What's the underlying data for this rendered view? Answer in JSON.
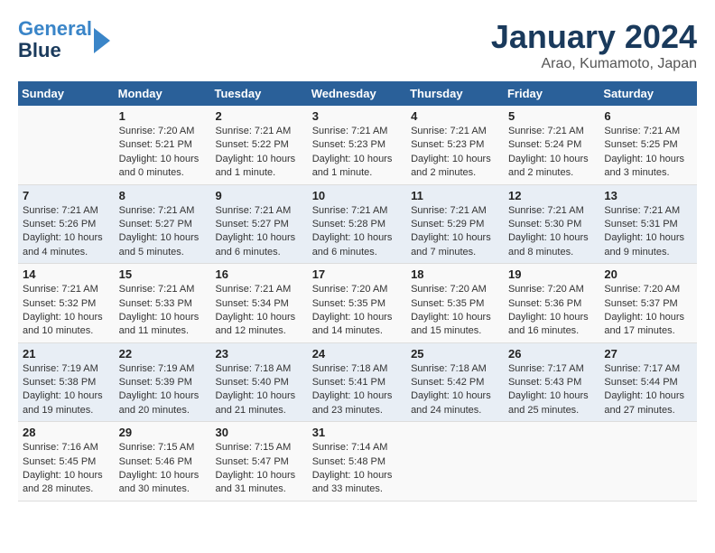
{
  "header": {
    "logo_line1": "General",
    "logo_line2": "Blue",
    "month_title": "January 2024",
    "location": "Arao, Kumamoto, Japan"
  },
  "days_of_week": [
    "Sunday",
    "Monday",
    "Tuesday",
    "Wednesday",
    "Thursday",
    "Friday",
    "Saturday"
  ],
  "weeks": [
    [
      {
        "day": "",
        "info": ""
      },
      {
        "day": "1",
        "info": "Sunrise: 7:20 AM\nSunset: 5:21 PM\nDaylight: 10 hours\nand 0 minutes."
      },
      {
        "day": "2",
        "info": "Sunrise: 7:21 AM\nSunset: 5:22 PM\nDaylight: 10 hours\nand 1 minute."
      },
      {
        "day": "3",
        "info": "Sunrise: 7:21 AM\nSunset: 5:23 PM\nDaylight: 10 hours\nand 1 minute."
      },
      {
        "day": "4",
        "info": "Sunrise: 7:21 AM\nSunset: 5:23 PM\nDaylight: 10 hours\nand 2 minutes."
      },
      {
        "day": "5",
        "info": "Sunrise: 7:21 AM\nSunset: 5:24 PM\nDaylight: 10 hours\nand 2 minutes."
      },
      {
        "day": "6",
        "info": "Sunrise: 7:21 AM\nSunset: 5:25 PM\nDaylight: 10 hours\nand 3 minutes."
      }
    ],
    [
      {
        "day": "7",
        "info": "Sunrise: 7:21 AM\nSunset: 5:26 PM\nDaylight: 10 hours\nand 4 minutes."
      },
      {
        "day": "8",
        "info": "Sunrise: 7:21 AM\nSunset: 5:27 PM\nDaylight: 10 hours\nand 5 minutes."
      },
      {
        "day": "9",
        "info": "Sunrise: 7:21 AM\nSunset: 5:27 PM\nDaylight: 10 hours\nand 6 minutes."
      },
      {
        "day": "10",
        "info": "Sunrise: 7:21 AM\nSunset: 5:28 PM\nDaylight: 10 hours\nand 6 minutes."
      },
      {
        "day": "11",
        "info": "Sunrise: 7:21 AM\nSunset: 5:29 PM\nDaylight: 10 hours\nand 7 minutes."
      },
      {
        "day": "12",
        "info": "Sunrise: 7:21 AM\nSunset: 5:30 PM\nDaylight: 10 hours\nand 8 minutes."
      },
      {
        "day": "13",
        "info": "Sunrise: 7:21 AM\nSunset: 5:31 PM\nDaylight: 10 hours\nand 9 minutes."
      }
    ],
    [
      {
        "day": "14",
        "info": "Sunrise: 7:21 AM\nSunset: 5:32 PM\nDaylight: 10 hours\nand 10 minutes."
      },
      {
        "day": "15",
        "info": "Sunrise: 7:21 AM\nSunset: 5:33 PM\nDaylight: 10 hours\nand 11 minutes."
      },
      {
        "day": "16",
        "info": "Sunrise: 7:21 AM\nSunset: 5:34 PM\nDaylight: 10 hours\nand 12 minutes."
      },
      {
        "day": "17",
        "info": "Sunrise: 7:20 AM\nSunset: 5:35 PM\nDaylight: 10 hours\nand 14 minutes."
      },
      {
        "day": "18",
        "info": "Sunrise: 7:20 AM\nSunset: 5:35 PM\nDaylight: 10 hours\nand 15 minutes."
      },
      {
        "day": "19",
        "info": "Sunrise: 7:20 AM\nSunset: 5:36 PM\nDaylight: 10 hours\nand 16 minutes."
      },
      {
        "day": "20",
        "info": "Sunrise: 7:20 AM\nSunset: 5:37 PM\nDaylight: 10 hours\nand 17 minutes."
      }
    ],
    [
      {
        "day": "21",
        "info": "Sunrise: 7:19 AM\nSunset: 5:38 PM\nDaylight: 10 hours\nand 19 minutes."
      },
      {
        "day": "22",
        "info": "Sunrise: 7:19 AM\nSunset: 5:39 PM\nDaylight: 10 hours\nand 20 minutes."
      },
      {
        "day": "23",
        "info": "Sunrise: 7:18 AM\nSunset: 5:40 PM\nDaylight: 10 hours\nand 21 minutes."
      },
      {
        "day": "24",
        "info": "Sunrise: 7:18 AM\nSunset: 5:41 PM\nDaylight: 10 hours\nand 23 minutes."
      },
      {
        "day": "25",
        "info": "Sunrise: 7:18 AM\nSunset: 5:42 PM\nDaylight: 10 hours\nand 24 minutes."
      },
      {
        "day": "26",
        "info": "Sunrise: 7:17 AM\nSunset: 5:43 PM\nDaylight: 10 hours\nand 25 minutes."
      },
      {
        "day": "27",
        "info": "Sunrise: 7:17 AM\nSunset: 5:44 PM\nDaylight: 10 hours\nand 27 minutes."
      }
    ],
    [
      {
        "day": "28",
        "info": "Sunrise: 7:16 AM\nSunset: 5:45 PM\nDaylight: 10 hours\nand 28 minutes."
      },
      {
        "day": "29",
        "info": "Sunrise: 7:15 AM\nSunset: 5:46 PM\nDaylight: 10 hours\nand 30 minutes."
      },
      {
        "day": "30",
        "info": "Sunrise: 7:15 AM\nSunset: 5:47 PM\nDaylight: 10 hours\nand 31 minutes."
      },
      {
        "day": "31",
        "info": "Sunrise: 7:14 AM\nSunset: 5:48 PM\nDaylight: 10 hours\nand 33 minutes."
      },
      {
        "day": "",
        "info": ""
      },
      {
        "day": "",
        "info": ""
      },
      {
        "day": "",
        "info": ""
      }
    ]
  ]
}
